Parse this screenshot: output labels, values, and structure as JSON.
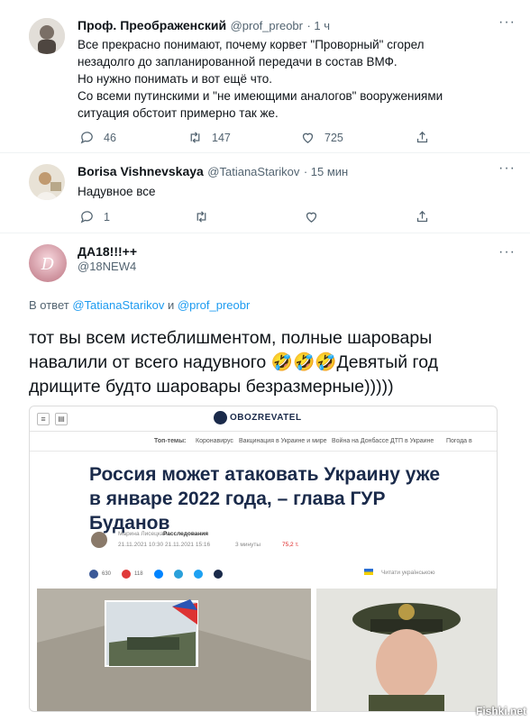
{
  "tweets": [
    {
      "name": "Проф. Преображенский",
      "handle": "@prof_preobr",
      "time": "· 1 ч",
      "lines": [
        "Все прекрасно понимают, почему корвет \"Проворный\" сгорел",
        "незадолго до запланированной передачи в состав ВМФ.",
        "Но нужно понимать и вот ещё что.",
        "Со всеми путинскими и \"не имеющими аналогов\" вооружениями",
        "ситуация обстоит примерно так же."
      ],
      "replies": "46",
      "retweets": "147",
      "likes": "725"
    },
    {
      "name": "Borisa Vishnevskaya",
      "handle": "@TatianaStarikov",
      "time": "· 15 мин",
      "text": "Надувное все",
      "replies": "1"
    },
    {
      "name": "ДА18!!!++",
      "handle": "@18NEW4",
      "reply_prefix": "В ответ",
      "reply_to_1": "@TatianaStarikov",
      "reply_and": "и",
      "reply_to_2": "@prof_preobr",
      "lines": [
        "тот вы всем истеблишментом, полные шаровары",
        "навалили от всего надувного 🤣🤣🤣Девятый  год",
        "дрищите будто шаровары безразмерные)))))"
      ]
    }
  ],
  "more_icon": "···",
  "embed": {
    "logo": "OBOZREVATEL",
    "nav": [
      "Топ-темы:",
      "Коронавирус",
      "Вакцинация в Украине и мире",
      "Война на Донбассе",
      "ДТП в Украине",
      "Погода в"
    ],
    "headline": "Россия может атаковать Украину уже в январе 2022 года, – глава ГУР Буданов",
    "author": "Марина Лисецкая",
    "category": "Расследования",
    "date1": "21.11.2021 10:30",
    "date2": "21.11.2021 15:16",
    "read_time": "3 минуты",
    "views": "75,2 т.",
    "fb_count": "630",
    "comments_count": "118",
    "read_ua": "Читати українською"
  },
  "watermark": "Fishki.net",
  "colors": {
    "accent": "#1d9bf0",
    "muted": "#536471",
    "headline": "#1a2a4a"
  }
}
